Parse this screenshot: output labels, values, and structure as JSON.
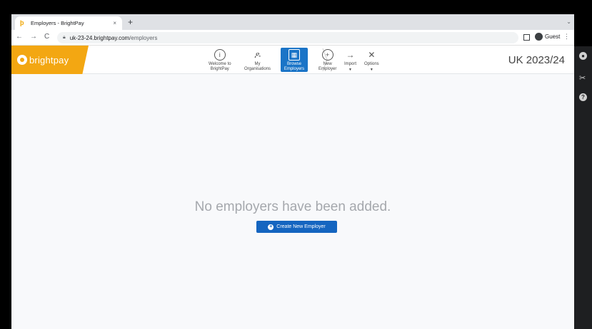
{
  "browser": {
    "tab_title": "Employers - BrightPay",
    "tab_close": "×",
    "new_tab": "+",
    "tab_menu": "⌄",
    "back": "←",
    "forward": "→",
    "reload": "C",
    "url_host": "uk-23-24.brightpay.com",
    "url_path": "/employers",
    "profile_label": "Guest",
    "menu": "⋮"
  },
  "app": {
    "brand": "brightpay",
    "brand_color": "#f3a712",
    "accent_color": "#1a74c7",
    "nav": [
      {
        "label_line1": "Welcome to",
        "label_line2": "BrightPay",
        "icon": "info-circle-icon",
        "glyph": "i"
      },
      {
        "label_line1": "My",
        "label_line2": "Organisations",
        "icon": "people-icon",
        "glyph": "ዶ"
      },
      {
        "label_line1": "Browse",
        "label_line2": "Employers",
        "icon": "building-icon",
        "glyph": "▦",
        "active": true
      },
      {
        "label_line1": "New",
        "label_line2": "Employer",
        "icon": "plus-circle-icon",
        "glyph": "+"
      },
      {
        "label_line1": "Import",
        "label_line2": "",
        "icon": "import-arrow-icon",
        "glyph": "→"
      },
      {
        "label_line1": "Options",
        "label_line2": "",
        "icon": "tools-icon",
        "glyph": "✕"
      }
    ],
    "tax_year": "UK 2023/24"
  },
  "main": {
    "empty_message": "No employers have been added.",
    "create_button": "Create New Employer"
  }
}
